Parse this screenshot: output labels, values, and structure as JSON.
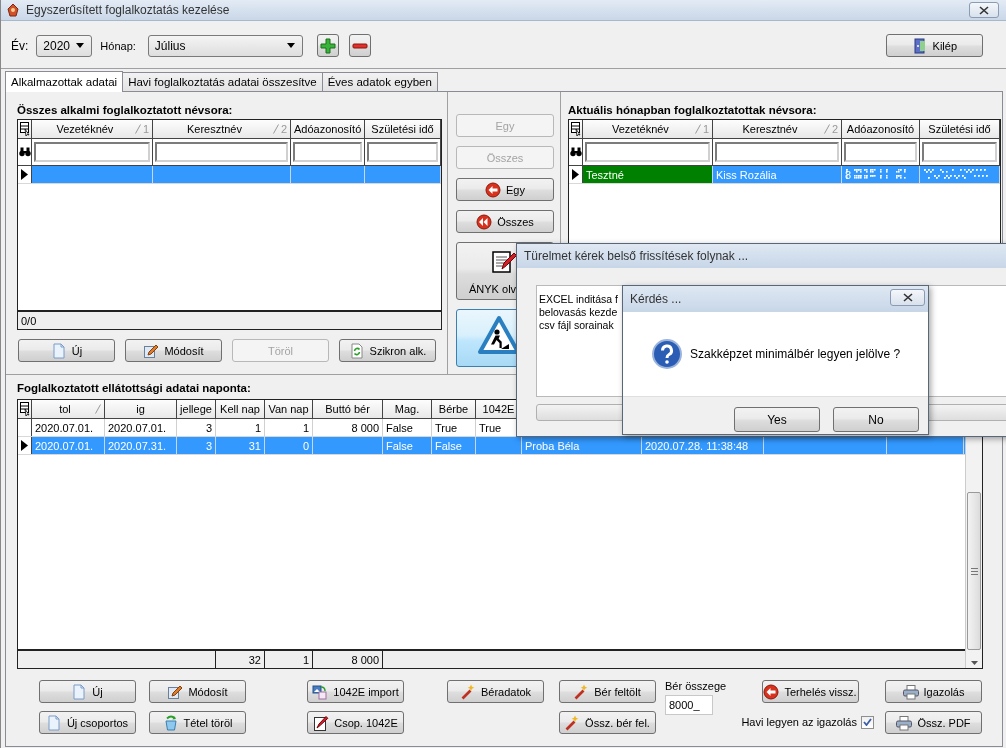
{
  "window": {
    "title": "Egyszerűsített foglalkoztatás kezelése"
  },
  "toolbar": {
    "year_label": "Év:",
    "year": "2020",
    "month_label": "Hónap:",
    "month": "Július",
    "exit_button": {
      "label": "Kilép"
    }
  },
  "tabs": [
    {
      "label": "Alkalmazottak adatai",
      "selected": true
    },
    {
      "label": "Havi foglalkoztatás adatai összesítve",
      "selected": false
    },
    {
      "label": "Éves adatok egyben",
      "selected": false
    }
  ],
  "all_employees": {
    "heading": "Összes alkalmi foglalkoztatott névsora:",
    "columns": [
      {
        "label": "Vezetéknév",
        "sorted": true,
        "sort_order": "1"
      },
      {
        "label": "Keresztnév",
        "sorted": true,
        "sort_order": "2"
      },
      {
        "label": "Adóazonosító",
        "sorted": false
      },
      {
        "label": "Születési idő",
        "sorted": false
      }
    ],
    "rows": [
      {
        "selected": true
      }
    ],
    "record_count": "0/0",
    "buttons": [
      {
        "label": "Új",
        "disabled": false
      },
      {
        "label": "Módosít",
        "disabled": false
      },
      {
        "label": "Töröl",
        "disabled": true
      },
      {
        "label": "Szikron alk.",
        "disabled": false
      }
    ]
  },
  "transfer_buttons": [
    {
      "kind": "small",
      "label": "Egy",
      "disabled": true,
      "highlighted": false
    },
    {
      "kind": "small",
      "label": "Összes",
      "disabled": true,
      "highlighted": false
    },
    {
      "kind": "small",
      "label": "Egy",
      "disabled": false,
      "highlighted": false
    },
    {
      "kind": "small",
      "label": "Összes",
      "disabled": false,
      "highlighted": false
    },
    {
      "kind": "large",
      "label": "ÁNYK olv",
      "disabled": false,
      "highlighted": false
    },
    {
      "kind": "large",
      "disabled": false,
      "highlighted": true
    }
  ],
  "monthly_employees": {
    "heading": "Aktuális hónapban foglalkoztatottak névsora:",
    "columns": [
      {
        "label": "Vezetéknév",
        "sorted": true,
        "sort_order": "1"
      },
      {
        "label": "Keresztnév",
        "sorted": true,
        "sort_order": "2"
      },
      {
        "label": "Adóazonosító",
        "sorted": false
      },
      {
        "label": "Születési idő",
        "sorted": false
      }
    ],
    "rows": [
      {
        "cells": [
          "Tesztné",
          "Kiss Rozália",
          "8",
          null
        ],
        "selected": true,
        "color": "#008000",
        "redacted": true
      }
    ]
  },
  "daily_data": {
    "heading": "Foglalkoztatott ellátottsági adatai naponta:",
    "columns": [
      {
        "label": "tol",
        "sorted": true
      },
      {
        "label": "ig",
        "sorted": false
      },
      {
        "label": "jellege",
        "sorted": false
      },
      {
        "label": "Kell nap",
        "sorted": false
      },
      {
        "label": "Van nap",
        "sorted": false
      },
      {
        "label": "Buttó bér",
        "sorted": false
      },
      {
        "label": "Mag.",
        "sorted": false
      },
      {
        "label": "Bérbe",
        "sorted": false
      },
      {
        "label": "1042E",
        "sorted": false
      }
    ],
    "rows": [
      {
        "cells": [
          "2020.07.01.",
          "2020.07.01.",
          "3",
          "1",
          "1",
          "8 000",
          "False",
          "True",
          "True"
        ],
        "selected": false
      },
      {
        "cells": [
          "2020.07.01.",
          "2020.07.31.",
          "3",
          "31",
          "0",
          null,
          "False",
          "False",
          null,
          "Proba Béla",
          "2020.07.28. 11:38:48"
        ],
        "selected": true
      }
    ],
    "totals": [
      "32",
      "1",
      "8 000"
    ]
  },
  "bottom_buttons": [
    {
      "label": "Új"
    },
    {
      "label": "Módosít"
    },
    {
      "label": "1042E import"
    },
    {
      "label": "Béradatok"
    },
    {
      "label": "Bér feltölt"
    },
    {
      "label": "Terhelés vissz."
    },
    {
      "label": "Igazolás"
    },
    {
      "label": "Új csoportos"
    },
    {
      "label": "Tétel töröl"
    },
    {
      "label": "Csop. 1042E"
    },
    {
      "label": "Össz. bér fel."
    },
    {
      "label": "Össz. PDF"
    }
  ],
  "wage": {
    "label": "Bér összege",
    "value": "8000_"
  },
  "monthly_certificate": {
    "label": "Havi legyen az igazolás",
    "checked": true
  },
  "progress_dialog": {
    "title": "Türelmet kérek belső frissítések folynak ...",
    "lines": [
      "EXCEL inditása f",
      "belovasás kezde",
      "csv fájl sorainak"
    ],
    "level": 0
  },
  "question_dialog": {
    "title": "Kérdés ...",
    "message": "Szakképzet minimálbér legyen jelölve ?",
    "buttons": [
      "Yes",
      "No"
    ]
  }
}
